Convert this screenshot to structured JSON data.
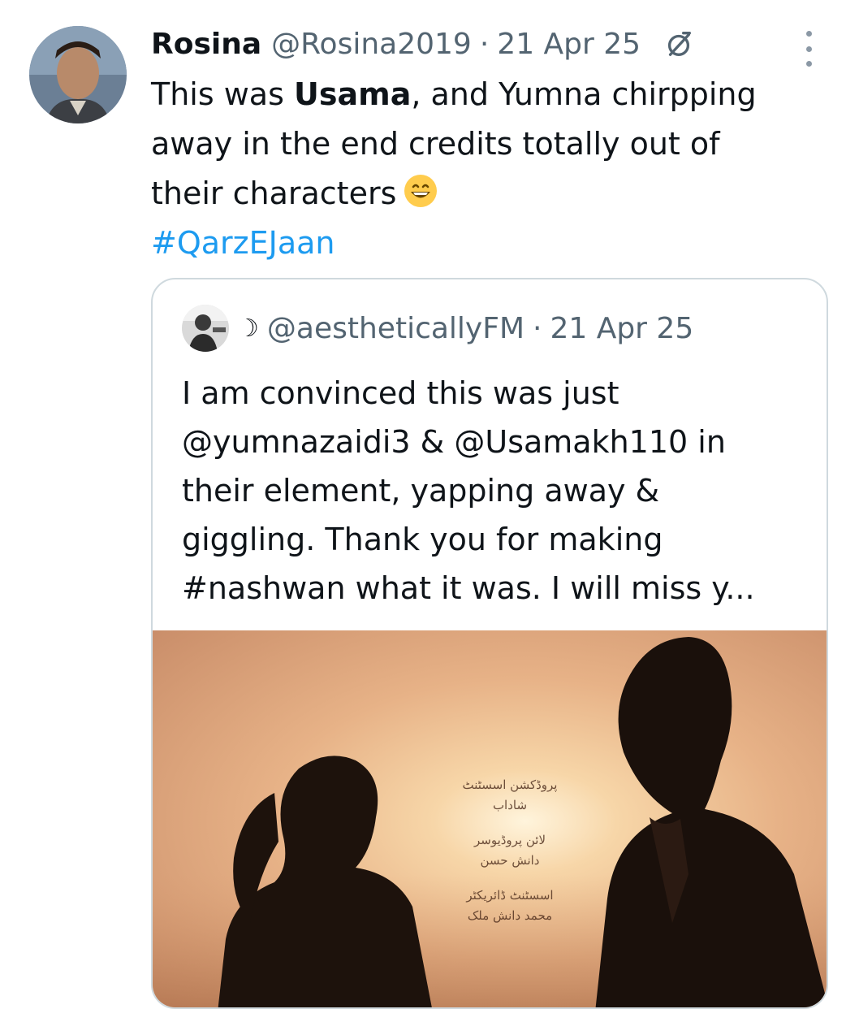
{
  "tweet": {
    "author_name": "Rosina",
    "handle": "@Rosina2019",
    "separator": "·",
    "timestamp": "21 Apr 25",
    "text": {
      "line1_pre": "This was ",
      "line1_bold": "Usama",
      "line1_post": ", and Yumna chirpping",
      "line2": "away in the end credits totally out of",
      "line3": "their characters",
      "hashtag": "#QarzEJaan"
    }
  },
  "quoted_tweet": {
    "name_symbol": "☽",
    "handle": "@aestheticallyFM",
    "separator": "·",
    "timestamp": "21 Apr 25",
    "lines": [
      "I am convinced this was just",
      "@yumnazaidi3 & @Usamakh110 in",
      "their element, yapping away &",
      "giggling. Thank you for making",
      "#nashwan what it was. I will miss y..."
    ],
    "media": {
      "credits": [
        "پروڈکشن اسسٹنٹ",
        "شاداب",
        "لائن پروڈیوسر",
        "دانش حسن",
        "اسسٹنٹ ڈائریکٹر",
        "محمد دانش ملک"
      ]
    }
  },
  "icons": {
    "verified": "verified-badge-icon",
    "more": "more-options-icon",
    "emoji": "grinning-face-emoji"
  },
  "colors": {
    "link": "#1d9bf0",
    "secondary_text": "#536471",
    "border": "#cfd9de"
  }
}
